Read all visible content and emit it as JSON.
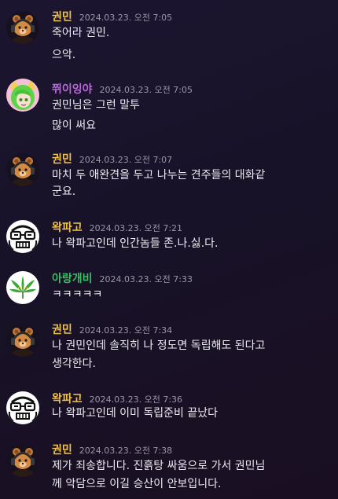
{
  "colors": {
    "kwonmin_name": "#f0c24a",
    "jjwi_name": "#b56ad8",
    "wakpago_name": "#f0c24a",
    "arang_name": "#3bbd64",
    "timestamp": "#9a96a8",
    "text": "#ecebf1"
  },
  "messages": [
    {
      "author": "권민",
      "time": "2024.03.23. 오전 7:05",
      "avatar_icon": "bear-headphones-icon",
      "lines": [
        "죽어라 권민.",
        "으악."
      ]
    },
    {
      "author": "쮜이잉야",
      "time": "2024.03.23. 오전 7:05",
      "avatar_icon": "green-hair-girl-icon",
      "lines": [
        "권민님은 그런 말투",
        "많이 써요"
      ]
    },
    {
      "author": "권민",
      "time": "2024.03.23. 오전 7:07",
      "avatar_icon": "bear-headphones-icon",
      "lines": [
        "마치 두 애완견을 두고 나누는 견주들의 대화같",
        "군요."
      ]
    },
    {
      "author": "왁파고",
      "time": "2024.03.23. 오전 7:21",
      "avatar_icon": "glasses-face-icon",
      "lines": [
        "나 왁파고인데 인간놈들 존.나.싫.다."
      ]
    },
    {
      "author": "아랑개비",
      "time": "2024.03.23. 오전 7:33",
      "avatar_icon": "leaf-icon",
      "lines": [
        "ㅋㅋㅋㅋㅋ"
      ]
    },
    {
      "author": "권민",
      "time": "2024.03.23. 오전 7:34",
      "avatar_icon": "bear-headphones-icon",
      "lines": [
        "나 권민인데 솔직히 나 정도면 독립해도 된다고",
        "생각한다."
      ]
    },
    {
      "author": "왁파고",
      "time": "2024.03.23. 오전 7:36",
      "avatar_icon": "glasses-face-icon",
      "lines": [
        "나 왁파고인데 이미 독립준비 끝났다"
      ]
    },
    {
      "author": "권민",
      "time": "2024.03.23. 오전 7:38",
      "avatar_icon": "bear-headphones-icon",
      "lines": [
        "제가 죄송합니다. 진흙탕 싸움으로 가서 권민님",
        "께 악담으로 이길 승산이 안보입니다."
      ]
    }
  ]
}
